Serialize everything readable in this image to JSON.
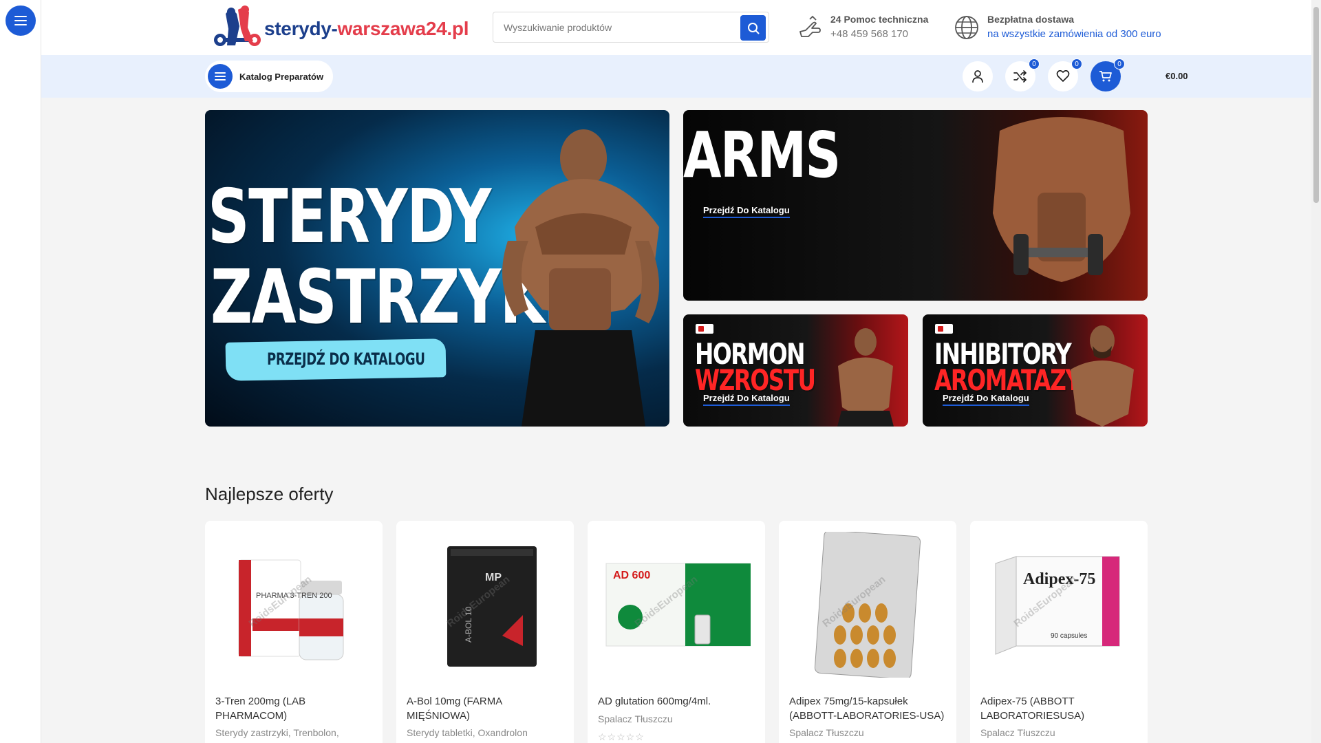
{
  "header": {
    "logo": {
      "part1": "sterydy-",
      "part2": "warszawa24.pl"
    },
    "search": {
      "placeholder": "Wyszukiwanie produktów"
    },
    "support": {
      "title": "24 Pomoc techniczna",
      "phone": "+48 459 568 170"
    },
    "delivery": {
      "title": "Bezpłatna dostawa",
      "subtitle": "na wszystkie zamówienia od 300 euro"
    }
  },
  "nav": {
    "catalog_label": "Katalog Preparatów",
    "compare_count": "0",
    "wishlist_count": "0",
    "cart_count": "0",
    "cart_total": "€0.00"
  },
  "banners": {
    "main": {
      "line1": "STERYDY",
      "line2": "ZASTRZYKI",
      "cta": "PRZEJDŹ DO KATALOGU"
    },
    "sarms": {
      "title": "ARMS",
      "cta": "Przejdź Do Katalogu"
    },
    "hormon": {
      "line1": "HORMON",
      "line2": "WZROSTU",
      "cta": "Przejdź Do Katalogu"
    },
    "inhibitory": {
      "line1": "INHIBITORY",
      "line2": "AROMATAZY",
      "cta": "Przejdź Do Katalogu"
    }
  },
  "section": {
    "title": "Najlepsze oferty"
  },
  "products": [
    {
      "name": "3-Tren 200mg (LAB PHARMACOM)",
      "category": "Sterydy zastrzyki, Trenbolon,",
      "image_label": "PHARMA 3-TREN 200",
      "watermark": "RoidsEuropean"
    },
    {
      "name": "A-Bol 10mg (FARMA MIĘŚNIOWA)",
      "category": "Sterydy tabletki, Oxandrolon",
      "image_label": "A-BOL 10",
      "watermark": "RoidsEuropean"
    },
    {
      "name": "AD glutation 600mg/4ml.",
      "category": "Spalacz Tłuszczu",
      "image_label": "AD 600",
      "watermark": "RoidsEuropean",
      "stars": "☆☆☆☆☆"
    },
    {
      "name": "Adipex 75mg/15-kapsułek (ABBOTT-LABORATORIES-USA)",
      "category": "Spalacz Tłuszczu",
      "image_label": "",
      "watermark": "RoidsEuropean"
    },
    {
      "name": "Adipex-75 (ABBOTT LABORATORIESUSA)",
      "category": "Spalacz Tłuszczu",
      "image_label": "Adipex-75",
      "image_sub": "90 capsules",
      "watermark": "RoidsEuropean"
    }
  ],
  "colors": {
    "accent": "#1d5bd6",
    "bar": "#e8f0fd",
    "logo_blue": "#1c3f8c",
    "logo_red": "#e43d4b"
  }
}
